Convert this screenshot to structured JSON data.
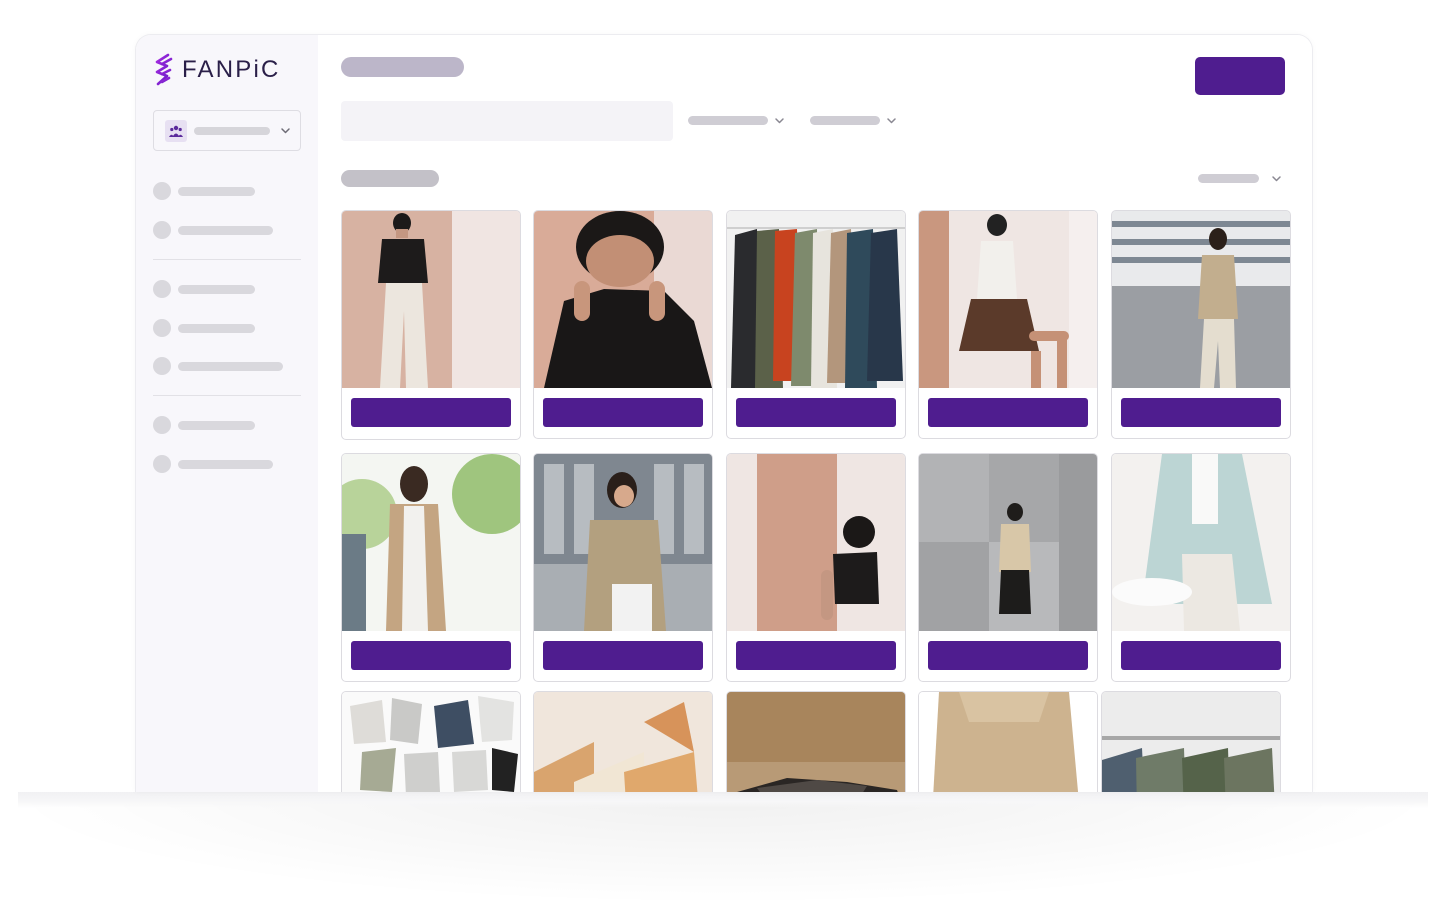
{
  "app": {
    "logo_text": "FANPiC",
    "brand_color": "#4f1d8f",
    "logo_color": "#8b2bd6"
  },
  "sidebar": {
    "org_selector_icon": "team-icon",
    "nav_groups": [
      [
        "nav-item-1",
        "nav-item-2"
      ],
      [
        "nav-item-3",
        "nav-item-4",
        "nav-item-5"
      ],
      [
        "nav-item-6",
        "nav-item-7"
      ]
    ]
  },
  "header": {
    "filters": [
      "filter-1",
      "filter-2"
    ],
    "sort_icon": "chevron-down-icon"
  },
  "gallery": {
    "rows": [
      [
        {
          "photo": "woman-black-vest-white-pants"
        },
        {
          "photo": "smiling-face-behind-black-sweater"
        },
        {
          "photo": "jackets-on-rack"
        },
        {
          "photo": "woman-pleated-skirt-seated"
        },
        {
          "photo": "woman-street-beige-outfit"
        }
      ],
      [
        {
          "photo": "woman-trench-vest-trees"
        },
        {
          "photo": "woman-phone-city"
        },
        {
          "photo": "person-black-vest-pink-wall"
        },
        {
          "photo": "person-concrete-wall"
        },
        {
          "photo": "light-blue-ruffle-shirt"
        }
      ],
      [
        {
          "photo": "clothes-flat-lay"
        },
        {
          "photo": "knitwear-on-hangers"
        },
        {
          "photo": "folded-sweaters"
        },
        {
          "photo": "beige-sweater-closeup"
        },
        {
          "photo": "shirts-on-rail"
        }
      ]
    ]
  }
}
